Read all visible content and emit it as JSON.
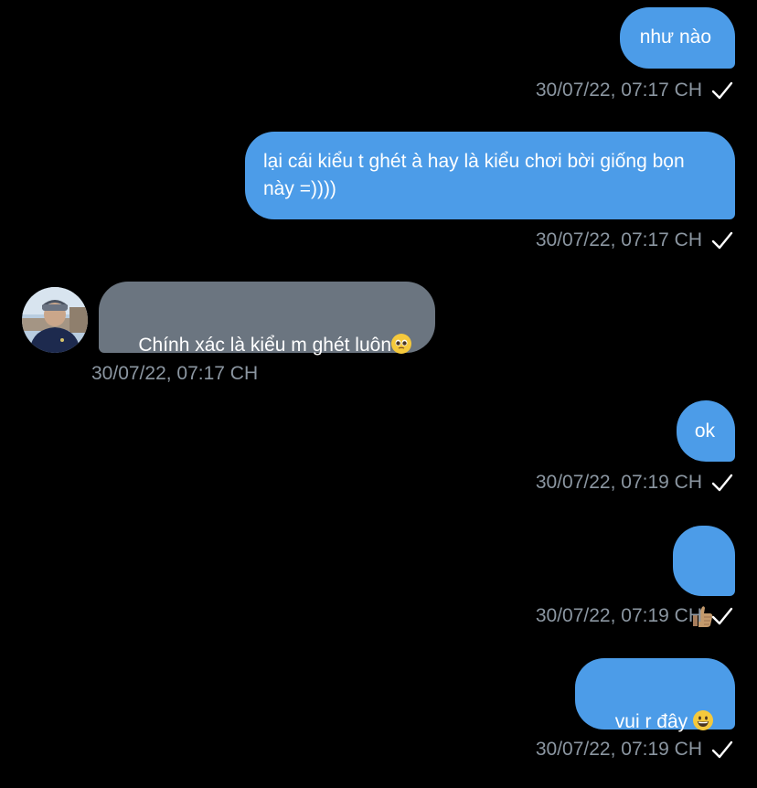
{
  "colors": {
    "background": "#000000",
    "outgoing_bubble": "#4c9ce8",
    "incoming_bubble": "#6b7580",
    "timestamp": "#8b96a1"
  },
  "messages": [
    {
      "direction": "outgoing",
      "text": "như nào",
      "time": "30/07/22, 07:17 CH",
      "status_icon": "checkmark-icon"
    },
    {
      "direction": "outgoing",
      "text": "lại cái kiểu t ghét à hay là kiểu chơi bời giống bọn này =))))",
      "time": "30/07/22, 07:17 CH",
      "status_icon": "checkmark-icon"
    },
    {
      "direction": "incoming",
      "text": "Chính xác là kiểu m ghét luôn",
      "emoji": "pleading-face-emoji",
      "time": "30/07/22, 07:17 CH",
      "avatar": "user-avatar"
    },
    {
      "direction": "outgoing",
      "text": "ok",
      "time": "30/07/22, 07:19 CH",
      "status_icon": "checkmark-icon"
    },
    {
      "direction": "outgoing",
      "emoji": "thumbs-up-emoji",
      "time": "30/07/22, 07:19 CH",
      "status_icon": "checkmark-icon"
    },
    {
      "direction": "outgoing",
      "text": "vui r đây",
      "emoji": "grinning-face-emoji",
      "time": "30/07/22, 07:19 CH",
      "status_icon": "checkmark-icon"
    }
  ]
}
